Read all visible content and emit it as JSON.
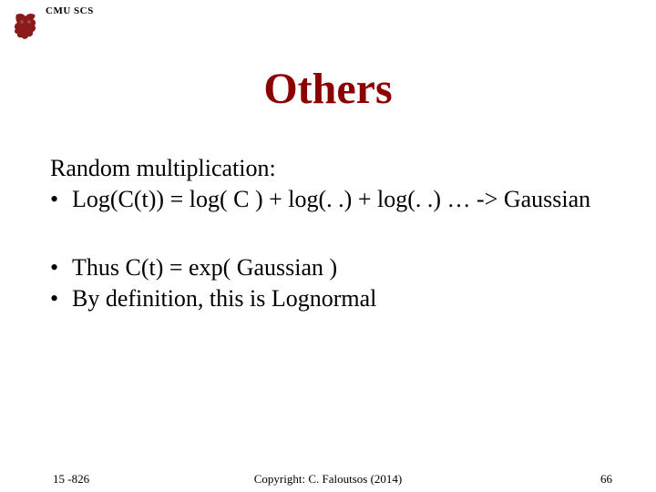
{
  "header": {
    "org": "CMU SCS"
  },
  "title": "Others",
  "body": {
    "section1": {
      "intro": "Random multiplication:",
      "bullet1": "Log(C(t)) = log( C ) + log(. .) + log(. .) … -> Gaussian"
    },
    "section2": {
      "bullet1": "Thus C(t) = exp( Gaussian )",
      "bullet2": "By definition, this is Lognormal"
    }
  },
  "footer": {
    "left": "15 -826",
    "center": "Copyright: C. Faloutsos (2014)",
    "right": "66"
  },
  "bullet_char": "•"
}
